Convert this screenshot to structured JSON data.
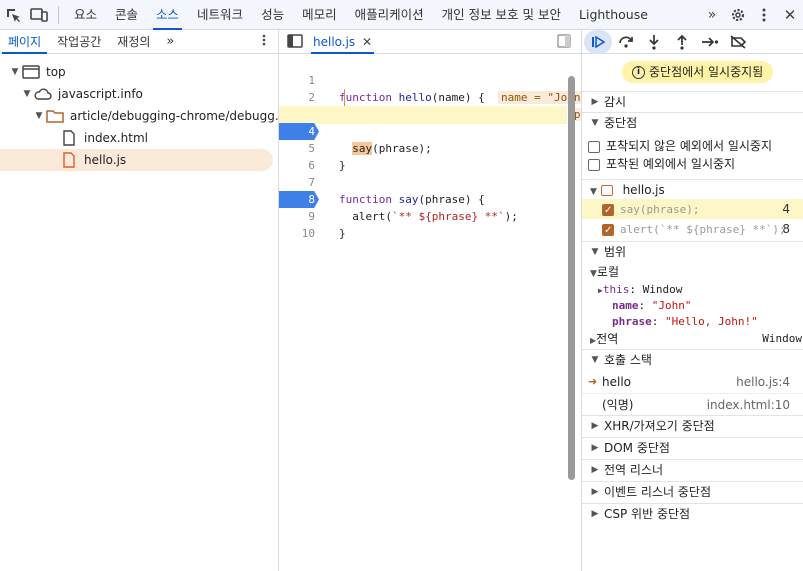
{
  "topbar": {
    "tabs": [
      "요소",
      "콘솔",
      "소스",
      "네트워크",
      "성능",
      "메모리",
      "애플리케이션",
      "개인 정보 보호 및 보안",
      "Lighthouse"
    ],
    "active_tab": "소스"
  },
  "navigator": {
    "tabs": [
      "페이지",
      "작업공간",
      "재정의"
    ],
    "active_tab": "페이지",
    "tree": [
      {
        "label": "top"
      },
      {
        "label": "javascript.info"
      },
      {
        "label": "article/debugging-chrome/debugg..."
      },
      {
        "label": "index.html"
      },
      {
        "label": "hello.js"
      }
    ]
  },
  "editor": {
    "file_tab": "hello.js",
    "line_numbers": [
      "1",
      "2",
      "3",
      "4",
      "5",
      "6",
      "7",
      "8",
      "9",
      "10"
    ],
    "inline_values": {
      "line1": "name = \"John\"",
      "line2": "ph"
    }
  },
  "debugger": {
    "paused_message": "중단점에서 일시중지됨",
    "sections": {
      "watch": "감시",
      "breakpoints": "중단점",
      "scope": "범위",
      "call_stack": "호출 스택",
      "xhr": "XHR/가져오기 중단점",
      "dom": "DOM 중단점",
      "global_listeners": "전역 리스너",
      "event_listeners": "이벤트 리스너 중단점",
      "csp": "CSP 위반 중단점"
    },
    "exceptions": {
      "uncaught": "포착되지 않은 예외에서 일시중지",
      "caught": "포착된 예외에서 일시중지"
    },
    "breakpoint_file": "hello.js",
    "breakpoint_items": [
      {
        "code": "say(phrase);",
        "line": "4"
      },
      {
        "code": "alert(`** ${phrase} **`);",
        "line": "8"
      }
    ],
    "scope": {
      "local_label": "로컬",
      "this_label": "this",
      "this_value": "Window",
      "vars": [
        {
          "name": "name",
          "value": "\"John\""
        },
        {
          "name": "phrase",
          "value": "\"Hello, John!\""
        }
      ],
      "global_label": "전역",
      "global_value": "Window"
    },
    "call_stack": [
      {
        "name": "hello",
        "loc": "hello.js:4"
      },
      {
        "name": "(익명)",
        "loc": "index.html:10"
      }
    ]
  },
  "colors": {
    "accent": "#0b57d0",
    "breakpoint": "#3f7fe8",
    "paused_highlight": "#fdf6c7"
  }
}
